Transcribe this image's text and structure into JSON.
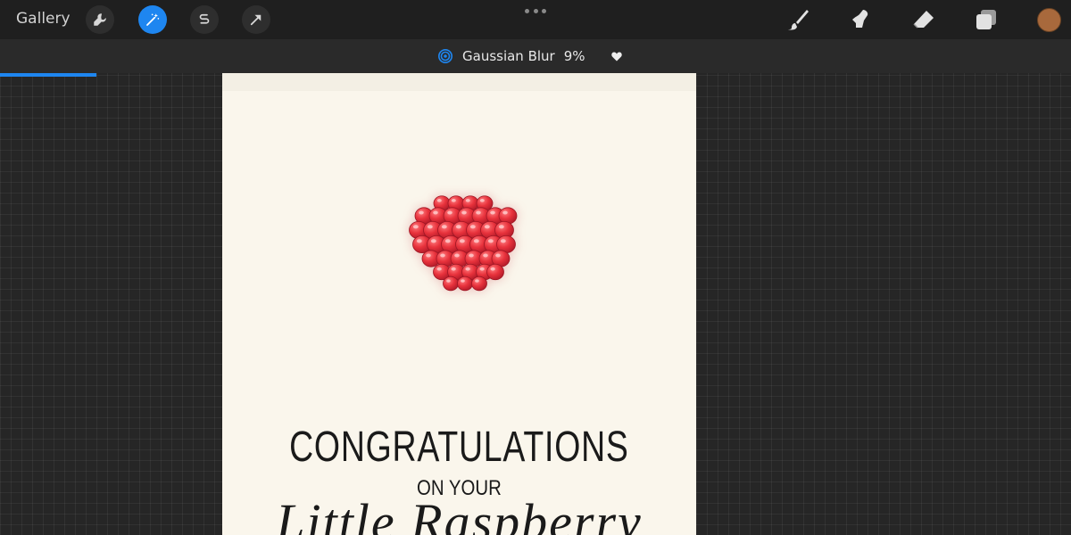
{
  "toolbar": {
    "gallery_label": "Gallery",
    "left_tools": [
      {
        "name": "wrench-icon",
        "active": false
      },
      {
        "name": "magic-wand-icon",
        "active": true
      },
      {
        "name": "selection-icon",
        "active": false
      },
      {
        "name": "transform-arrow-icon",
        "active": false
      }
    ],
    "right_tools": [
      "brush-icon",
      "smudge-icon",
      "eraser-icon",
      "layers-icon"
    ],
    "current_color": "#a8693c",
    "accent_color": "#1e86f0"
  },
  "adjustment": {
    "icon": "gaussian-blur-icon",
    "name": "Gaussian Blur",
    "value": "9%",
    "value_fraction": 0.09
  },
  "canvas": {
    "headline": "CONGRATULATIONS",
    "subline": "ON YOUR",
    "script_line": "Little Raspberry",
    "illustration": "raspberry-illustration"
  }
}
